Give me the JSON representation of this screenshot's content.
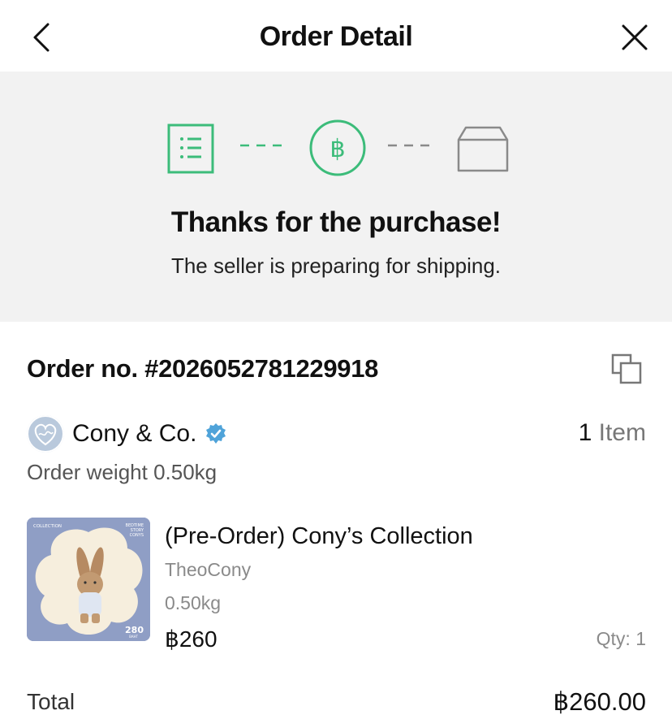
{
  "header": {
    "title": "Order Detail",
    "back_icon": "chevron-left-icon",
    "close_icon": "close-icon"
  },
  "status": {
    "steps": [
      {
        "icon": "order-list-icon",
        "state": "done"
      },
      {
        "icon": "baht-payment-icon",
        "state": "current"
      },
      {
        "icon": "box-shipping-icon",
        "state": "pending"
      }
    ],
    "heading": "Thanks for the purchase!",
    "message": "The seller is preparing for shipping.",
    "active_color": "#3cbc7a",
    "inactive_color": "#8a8a8a"
  },
  "order": {
    "number": "Order no. #2026052781229918",
    "copy_icon": "copy-icon"
  },
  "seller": {
    "name": "Cony & Co.",
    "verified_icon": "verified-badge-icon",
    "item_count": "1",
    "item_word": "Item",
    "order_weight": "Order weight 0.50kg"
  },
  "product": {
    "name": "(Pre-Order) Cony’s Collection",
    "seller": "TheoCony",
    "weight": "0.50kg",
    "price": "฿260",
    "qty": "Qty: 1",
    "image_text": {
      "top_left": "COLLECTION",
      "top_right_1": "BEDTIME",
      "top_right_2": "STORY",
      "top_right_3": "CONYS",
      "price_tag": "280",
      "price_tag_sub": "BAHT"
    }
  },
  "total": {
    "label": "Total",
    "value": "฿260.00"
  }
}
